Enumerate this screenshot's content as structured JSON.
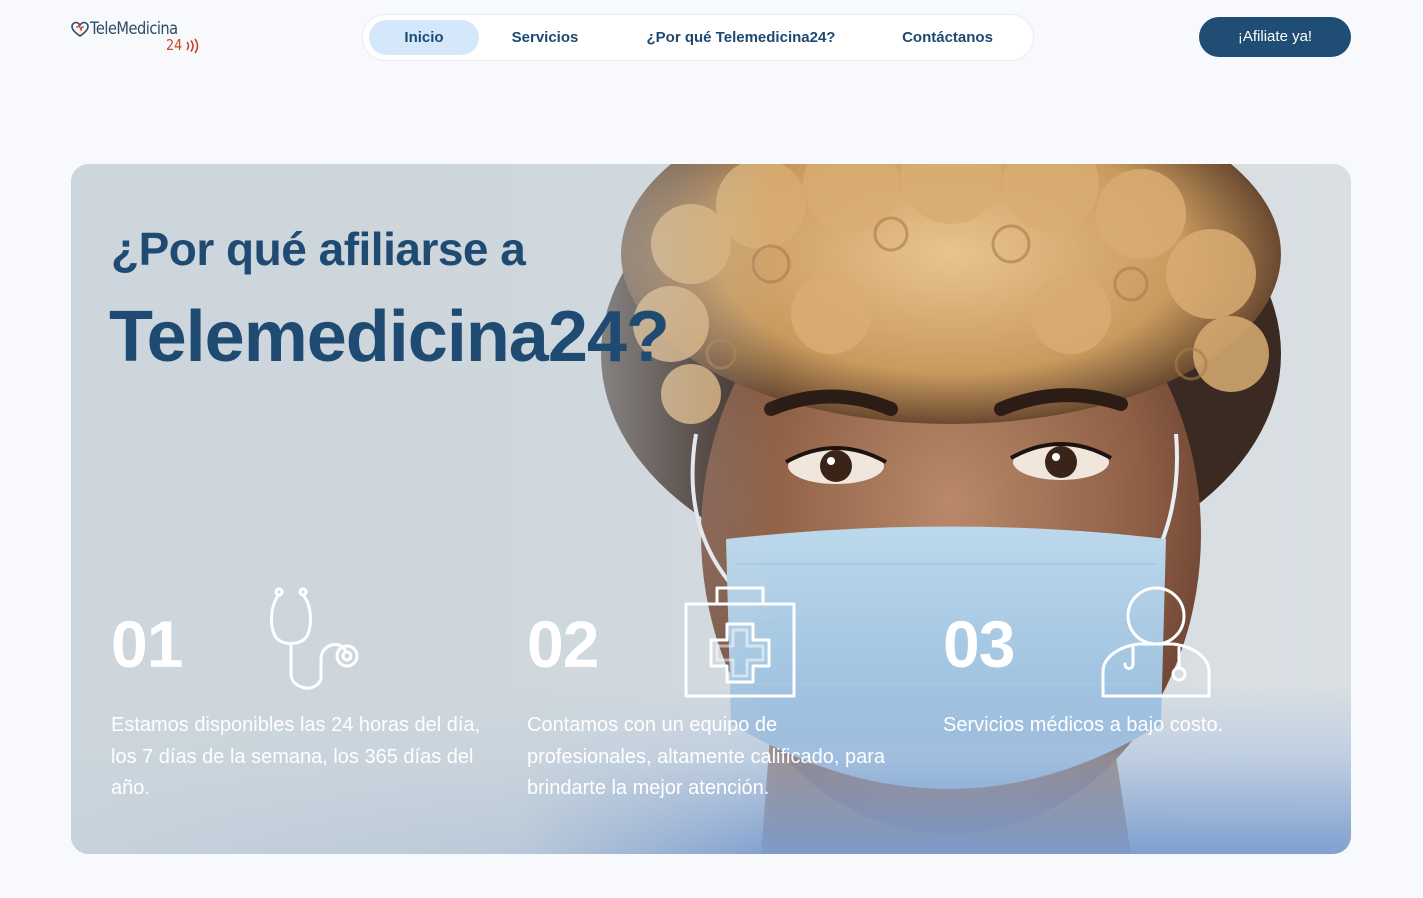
{
  "header": {
    "logo": {
      "name": "TeleMedicina",
      "suffix": "24",
      "icon": "stethoscope-heart-icon"
    },
    "nav": [
      {
        "label": "Inicio",
        "active": true
      },
      {
        "label": "Servicios",
        "active": false
      },
      {
        "label": "¿Por qué Telemedicina24?",
        "active": false
      },
      {
        "label": "Contáctanos",
        "active": false
      }
    ],
    "cta_label": "¡Afiliate ya!"
  },
  "hero": {
    "title_line1": "¿Por qué afiliarse a",
    "title_line2": "Telemedicina24?",
    "features": [
      {
        "number": "01",
        "icon": "stethoscope-icon",
        "text": "Estamos disponibles las 24 horas del día, los 7 días de la semana, los 365 días del año."
      },
      {
        "number": "02",
        "icon": "first-aid-kit-icon",
        "text": "Contamos con un equipo de profesionales, altamente calificado, para brindarte la mejor atención."
      },
      {
        "number": "03",
        "icon": "doctor-icon",
        "text": "Servicios médicos a bajo costo."
      }
    ]
  },
  "colors": {
    "brand_dark": "#1f4b73",
    "nav_active_bg": "#d5e7fa",
    "logo_accent": "#c7452b",
    "cta_bg": "#1f4d73"
  }
}
